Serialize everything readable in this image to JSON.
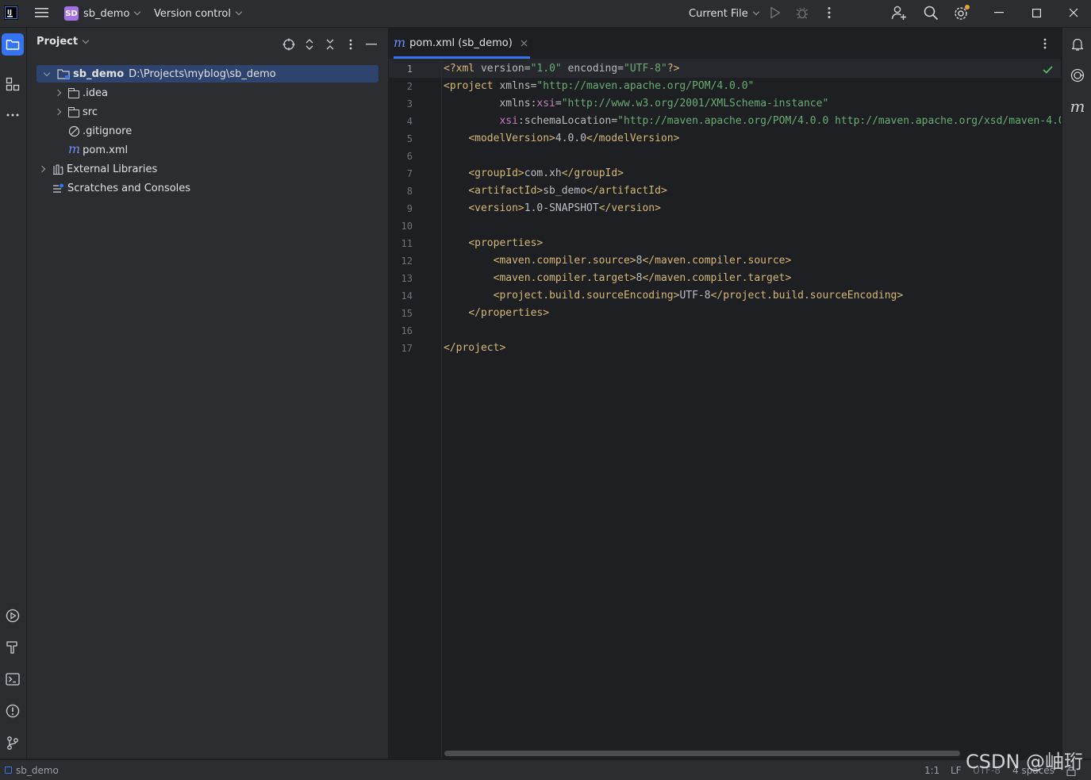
{
  "titlebar": {
    "project_badge": "SD",
    "project_name": "sb_demo",
    "vcs_label": "Version control",
    "run_config": "Current File",
    "icons": [
      "app-logo-icon",
      "hamburger-menu-icon",
      "run-icon",
      "debug-icon",
      "more-vert-icon",
      "add-user-icon",
      "search-icon",
      "settings-icon",
      "minimize-icon",
      "maximize-icon",
      "close-icon"
    ]
  },
  "project_panel": {
    "title": "Project",
    "tree": [
      {
        "name": "sb_demo",
        "path": "D:\\Projects\\myblog\\sb_demo",
        "icon": "module-folder-icon",
        "expanded": true,
        "selected": true
      },
      {
        "name": ".idea",
        "icon": "folder-icon",
        "expanded": false
      },
      {
        "name": "src",
        "icon": "folder-icon",
        "expanded": false
      },
      {
        "name": ".gitignore",
        "icon": "ignore-file-icon"
      },
      {
        "name": "pom.xml",
        "icon": "maven-icon"
      },
      {
        "name": "External Libraries",
        "icon": "libraries-icon",
        "expanded": false
      },
      {
        "name": "Scratches and Consoles",
        "icon": "scratches-icon"
      }
    ]
  },
  "editor": {
    "tab_label": "pom.xml (sb_demo)",
    "line_numbers": [
      "1",
      "2",
      "3",
      "4",
      "5",
      "6",
      "7",
      "8",
      "9",
      "10",
      "11",
      "12",
      "13",
      "14",
      "15",
      "16",
      "17"
    ],
    "current_line": 1
  },
  "statusbar": {
    "breadcrumb": "sb_demo",
    "position": "1:1",
    "line_separator": "LF",
    "encoding": "UTF-8",
    "indent": "4 spaces"
  },
  "watermark": "CSDN @岫珩",
  "colors": {
    "background": "#1e1f22",
    "panel": "#2b2d30",
    "selection": "#2e436e",
    "accent": "#3574f0",
    "xml_tag": "#d5b778",
    "xml_string": "#6aab73",
    "xml_namespace": "#c77dbb"
  }
}
